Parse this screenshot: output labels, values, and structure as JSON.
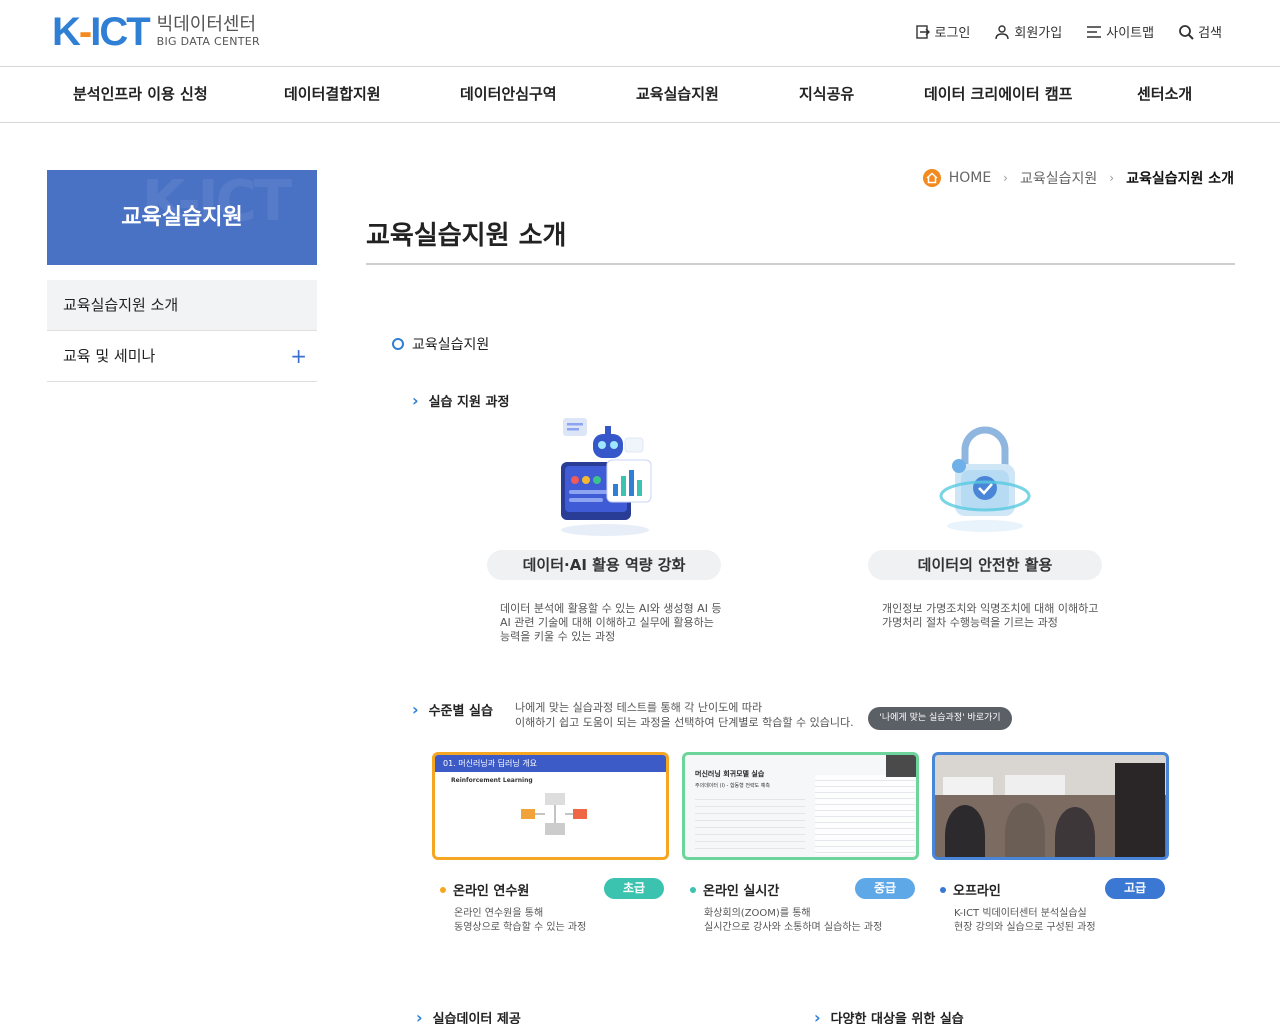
{
  "header": {
    "logo_k": "K",
    "logo_dash": "-",
    "logo_ict": "ICT",
    "logo_kr": "빅데이터센터",
    "logo_en": "BIG DATA CENTER",
    "util": [
      {
        "label": "로그인",
        "icon": "login-icon"
      },
      {
        "label": "회원가입",
        "icon": "user-icon"
      },
      {
        "label": "사이트맵",
        "icon": "menu-icon"
      },
      {
        "label": "검색",
        "icon": "search-icon"
      }
    ]
  },
  "gnb": [
    "분석인프라 이용 신청",
    "데이터결합지원",
    "데이터안심구역",
    "교육실습지원",
    "지식공유",
    "데이터 크리에이터 캠프",
    "센터소개"
  ],
  "sidebar": {
    "title": "교육실습지원",
    "items": [
      {
        "label": "교육실습지원 소개",
        "active": true
      },
      {
        "label": "교육 및 세미나",
        "expand": "+"
      }
    ]
  },
  "breadcrumb": {
    "home": "HOME",
    "level1": "교육실습지원",
    "current": "교육실습지원 소개"
  },
  "page": {
    "title": "교육실습지원 소개",
    "section": "교육실습지원",
    "practice_label": "실습 지원 과정",
    "features": [
      {
        "title": "데이터·AI 활용 역량 강화",
        "lines": [
          "데이터 분석에 활용할 수 있는 AI와 생성형 AI 등",
          "AI 관련 기술에 대해 이해하고 실무에 활용하는",
          "능력을 키울 수 있는 과정"
        ]
      },
      {
        "title": "데이터의 안전한 활용",
        "lines": [
          "개인정보 가명조치와 익명조치에 대해 이해하고",
          "가명처리 절차 수행능력을 기르는 과정"
        ]
      }
    ],
    "level_label": "수준별 실습",
    "level_desc": [
      "나에게 맞는 실습과정 테스트를 통해 각 난이도에 따라",
      "이해하기 쉽고 도움이 되는 과정을 선택하여 단계별로 학습할 수 있습니다."
    ],
    "level_button": "'나에게 맞는 실습과정' 바로가기",
    "thumb_texts": {
      "slide_title": "01. 머신러닝과 딥러닝 개요",
      "slide_sub": "Reinforcement Learning",
      "code_title": "머신러닝 회귀모델 실습",
      "code_sub": "주의데이터 (I) - 합동형 전략도 예측"
    },
    "courses": [
      {
        "name": "온라인 연수원",
        "level": "초급",
        "color": "#f5a623",
        "badge": "#3cc3b0",
        "lines": [
          "온라인 연수원을 통해",
          "동영상으로 학습할 수 있는 과정"
        ]
      },
      {
        "name": "온라인 실시간",
        "level": "중급",
        "color": "#3cc3b0",
        "badge": "#5fa8e8",
        "lines": [
          "화상회의(ZOOM)를 통해",
          "실시간으로 강사와 소통하며 실습하는 과정"
        ]
      },
      {
        "name": "오프라인",
        "level": "고급",
        "color": "#3a78d4",
        "badge": "#3a78d4",
        "lines": [
          "K-ICT 빅데이터센터 분석실습실",
          "현장 강의와 실습으로 구성된 과정"
        ]
      }
    ],
    "bottom": [
      "실습데이터 제공",
      "다양한 대상을 위한 실습"
    ]
  }
}
